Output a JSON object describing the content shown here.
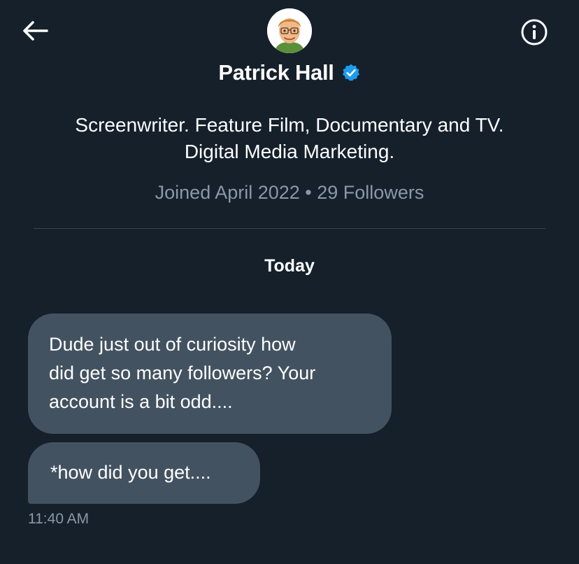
{
  "header": {
    "back_icon": "arrow-left-icon",
    "info_icon": "info-circle-icon"
  },
  "profile": {
    "avatar_icon": "memoji-avatar",
    "display_name": "Patrick Hall",
    "verified_icon": "verified-badge-icon",
    "bio_lines": [
      "Screenwriter. Feature Film, Documentary and TV.",
      "Digital Media Marketing."
    ],
    "meta": "Joined April 2022 • 29 Followers"
  },
  "conversation": {
    "date_label": "Today",
    "messages": [
      {
        "lines": [
          "Dude just out of curiosity how",
          "did get so many followers? Your",
          "account is a bit odd...."
        ]
      },
      {
        "text": "*how did you get...."
      }
    ],
    "timestamp": "11:40 AM"
  },
  "colors": {
    "background": "#15202b",
    "bubble": "#435260",
    "muted_text": "#8b98a5",
    "verified_blue": "#1d9bf0",
    "divider": "#38444d"
  }
}
